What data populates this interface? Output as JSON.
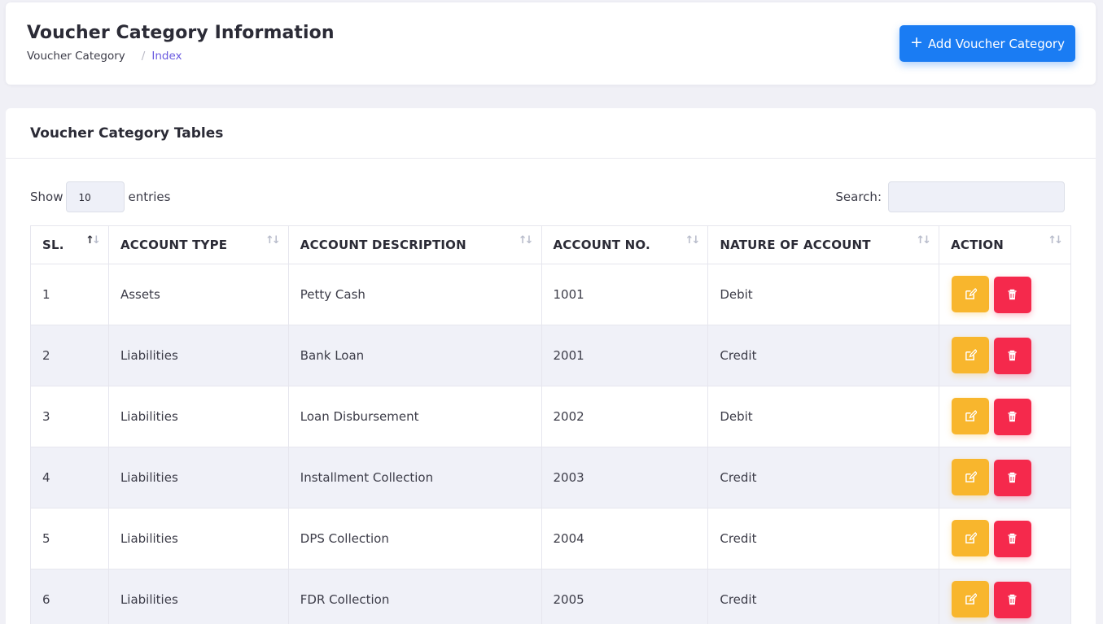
{
  "header": {
    "title": "Voucher Category Information",
    "breadcrumb": [
      "Voucher Category",
      "Index"
    ],
    "separator": "/",
    "add_button": "Add Voucher Category",
    "add_icon": "plus-icon"
  },
  "table_card": {
    "title": "Voucher Category Tables",
    "show_label": "Show",
    "entries_value": "10",
    "entries_label": "entries",
    "search_label": "Search:",
    "search_value": ""
  },
  "columns": [
    "SL.",
    "ACCOUNT TYPE",
    "ACCOUNT DESCRIPTION",
    "ACCOUNT NO.",
    "NATURE OF ACCOUNT",
    "ACTION"
  ],
  "rows": [
    {
      "sl": "1",
      "type": "Assets",
      "description": "Petty Cash",
      "number": "1001",
      "nature": "Debit"
    },
    {
      "sl": "2",
      "type": "Liabilities",
      "description": "Bank Loan",
      "number": "2001",
      "nature": "Credit"
    },
    {
      "sl": "3",
      "type": "Liabilities",
      "description": "Loan Disbursement",
      "number": "2002",
      "nature": "Debit"
    },
    {
      "sl": "4",
      "type": "Liabilities",
      "description": "Installment Collection",
      "number": "2003",
      "nature": "Credit"
    },
    {
      "sl": "5",
      "type": "Liabilities",
      "description": "DPS Collection",
      "number": "2004",
      "nature": "Credit"
    },
    {
      "sl": "6",
      "type": "Liabilities",
      "description": "FDR Collection",
      "number": "2005",
      "nature": "Credit"
    }
  ],
  "colors": {
    "primary": "#1a7cf3",
    "edit": "#f8b62d",
    "delete": "#f5294c",
    "breadcrumb_active": "#6a5ae0"
  }
}
